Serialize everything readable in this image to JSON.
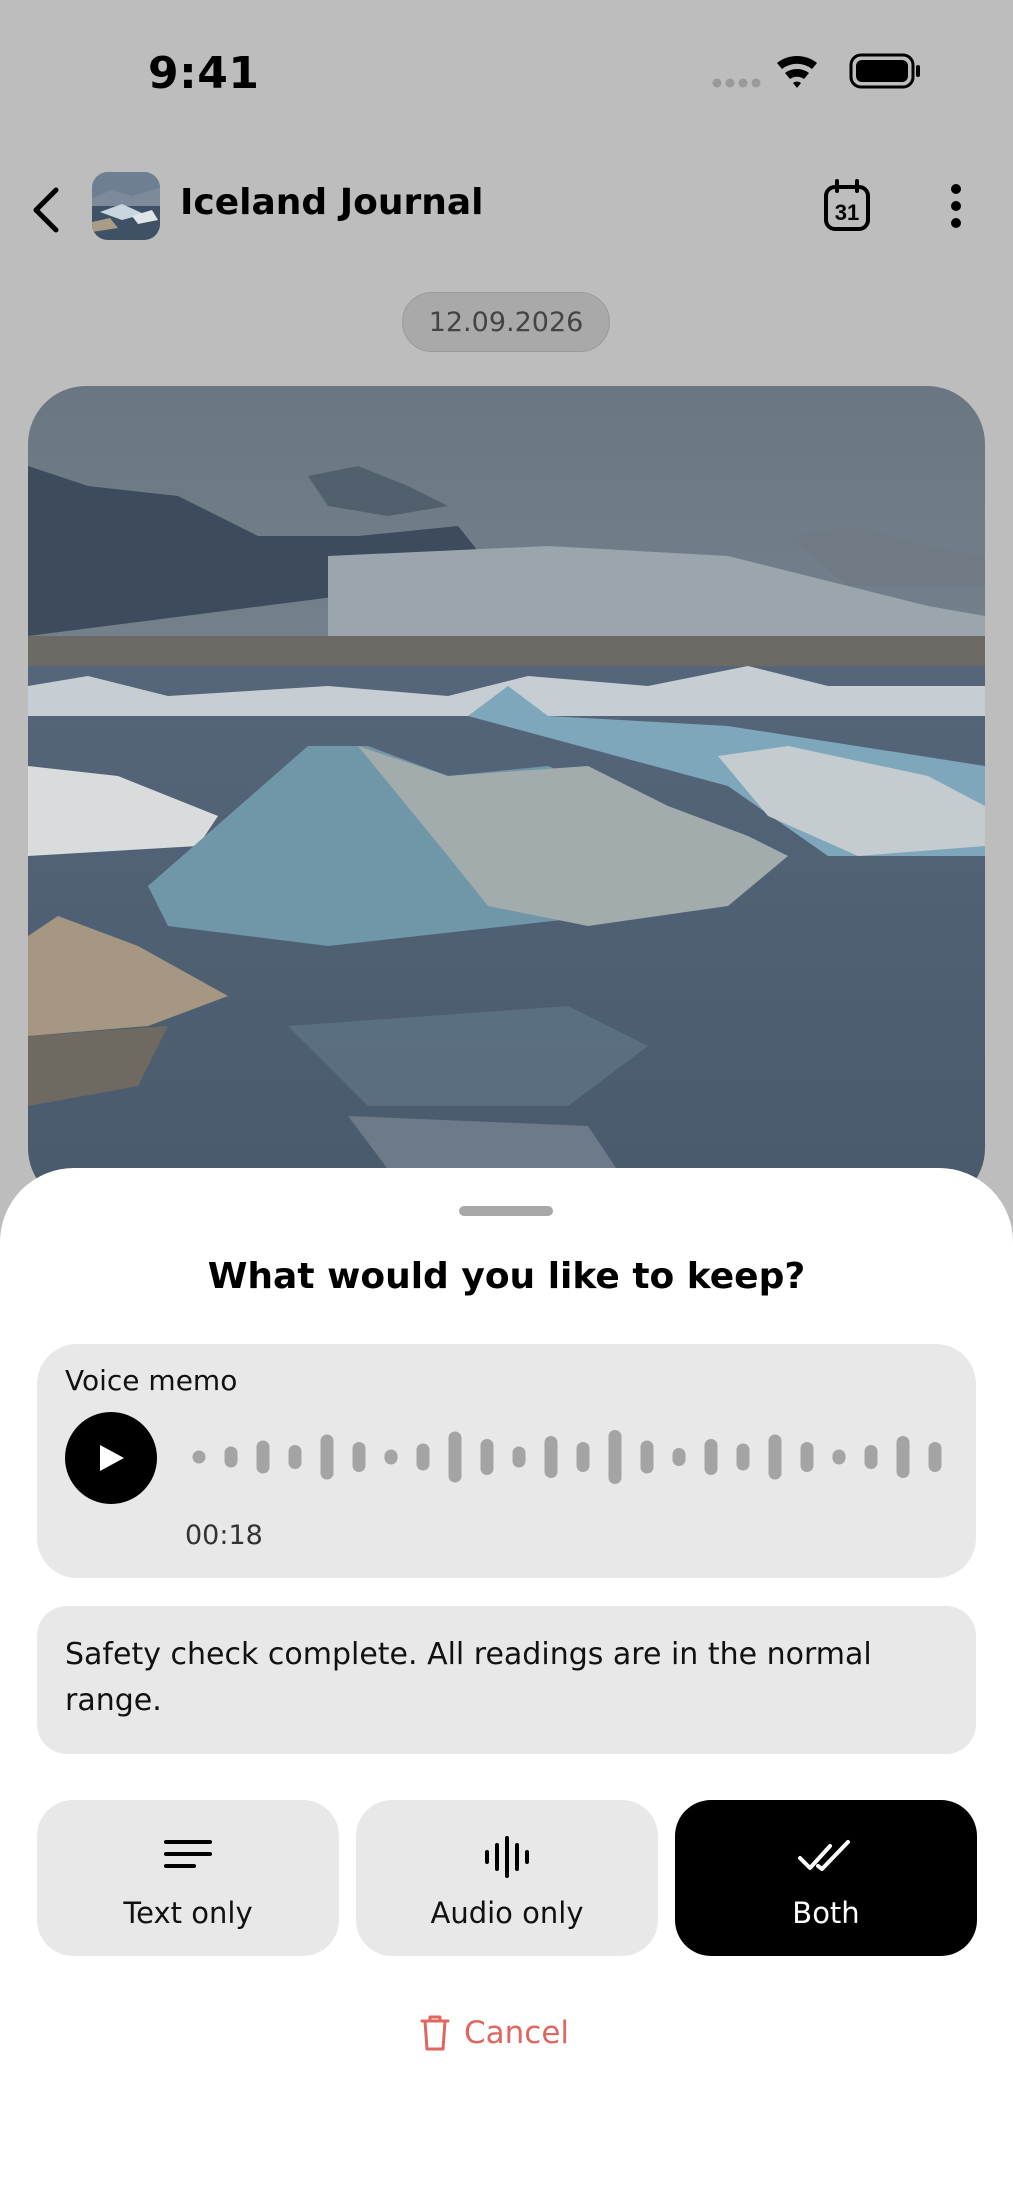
{
  "status_bar": {
    "time": "9:41"
  },
  "header": {
    "title": "Iceland Journal",
    "calendar_day": "31"
  },
  "date_chip": "12.09.2026",
  "sheet": {
    "title": "What would you like to keep?",
    "voice_memo": {
      "label": "Voice memo",
      "duration": "00:18",
      "bar_levels": [
        0.2,
        0.35,
        0.55,
        0.4,
        0.75,
        0.5,
        0.25,
        0.45,
        0.85,
        0.6,
        0.35,
        0.7,
        0.5,
        0.9,
        0.55,
        0.3,
        0.6,
        0.45,
        0.75,
        0.5,
        0.25,
        0.4,
        0.7,
        0.5
      ]
    },
    "transcript": "Safety check complete. All readings are in the normal range.",
    "options": [
      {
        "label": "Text only",
        "icon": "text-lines-icon"
      },
      {
        "label": "Audio only",
        "icon": "audio-wave-icon"
      },
      {
        "label": "Both",
        "icon": "double-check-icon",
        "selected": true
      }
    ],
    "cancel_label": "Cancel"
  },
  "colors": {
    "dim_background": "#bdbdbd",
    "card": "#e8e8e8",
    "selected_option": "#000000",
    "cancel": "#e0675f"
  }
}
